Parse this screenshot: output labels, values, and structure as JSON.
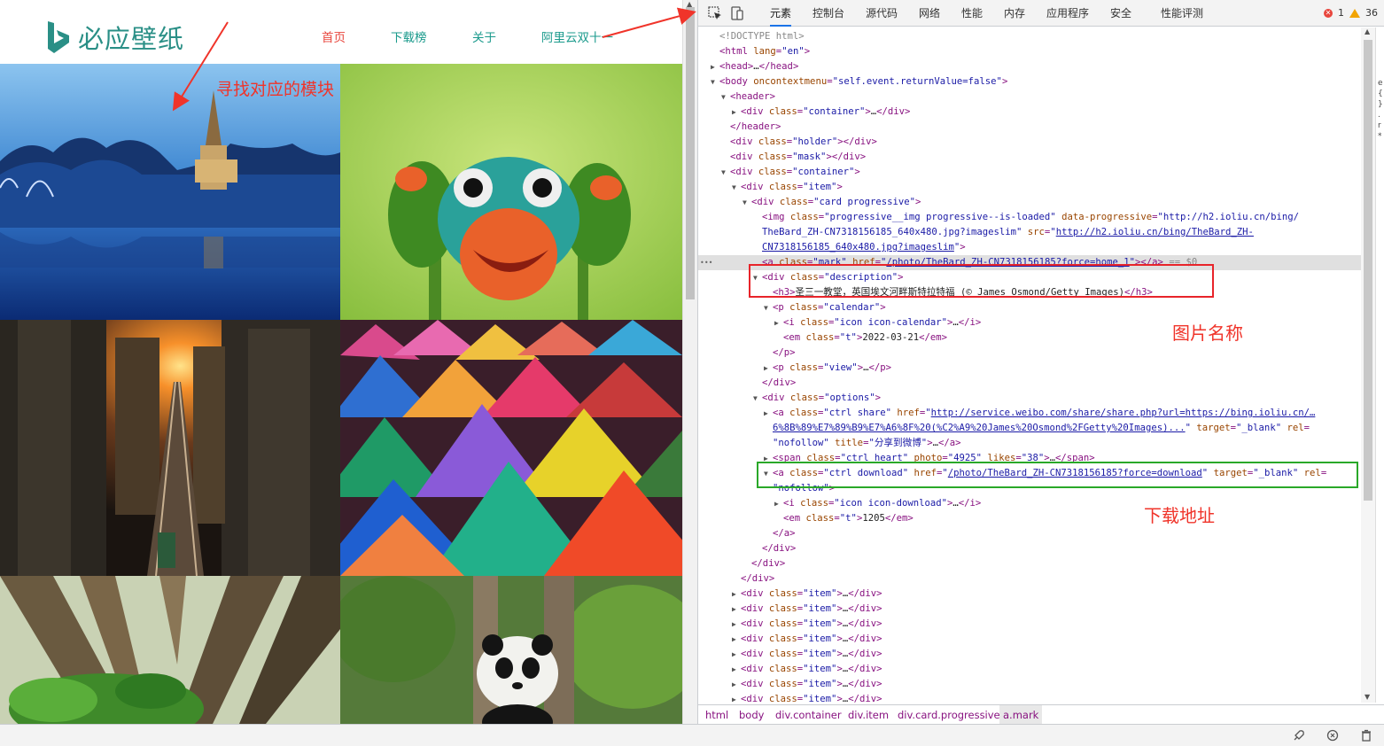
{
  "site": {
    "logo_text": "必应壁纸",
    "nav": [
      {
        "label": "首页",
        "active": true
      },
      {
        "label": "下载榜",
        "active": false
      },
      {
        "label": "关于",
        "active": false
      },
      {
        "label": "阿里云双十一",
        "active": false
      }
    ],
    "annotation": "寻找对应的模块",
    "tiles": [
      {
        "name": "church-winter-lake"
      },
      {
        "name": "frog-on-flower-bud"
      },
      {
        "name": "city-sunset-railway"
      },
      {
        "name": "colorful-powder-piles"
      },
      {
        "name": "redwood-forest"
      },
      {
        "name": "panda-on-tree"
      }
    ]
  },
  "devtools": {
    "tabs": [
      "元素",
      "控制台",
      "源代码",
      "网络",
      "性能",
      "内存",
      "应用程序",
      "安全",
      "性能评测"
    ],
    "active_tab": "元素",
    "errors": "1",
    "warnings": "36",
    "annotations": {
      "image_name": "图片名称",
      "download_url": "下载地址"
    },
    "dom_lines": [
      {
        "indent": 0,
        "tri": "",
        "html": "<span class=\"cmt\">&lt;!DOCTYPE html&gt;</span>"
      },
      {
        "indent": 0,
        "tri": "",
        "html": "<span class=\"tag\">&lt;html </span><span class=\"attr\">lang</span><span class=\"tag\">=</span><span class=\"val\">\"en\"</span><span class=\"tag\">&gt;</span>"
      },
      {
        "indent": 0,
        "tri": "▶",
        "html": "<span class=\"tag\">&lt;head&gt;</span><span class=\"txt\">…</span><span class=\"tag\">&lt;/head&gt;</span>"
      },
      {
        "indent": 0,
        "tri": "▼",
        "html": "<span class=\"tag\">&lt;body </span><span class=\"attr\">oncontextmenu</span><span class=\"tag\">=</span><span class=\"val\">\"self.event.returnValue=false\"</span><span class=\"tag\">&gt;</span>"
      },
      {
        "indent": 1,
        "tri": "▼",
        "html": "<span class=\"tag\">&lt;header&gt;</span>"
      },
      {
        "indent": 2,
        "tri": "▶",
        "html": "<span class=\"tag\">&lt;div </span><span class=\"attr\">class</span><span class=\"tag\">=</span><span class=\"val\">\"container\"</span><span class=\"tag\">&gt;</span><span class=\"txt\">…</span><span class=\"tag\">&lt;/div&gt;</span>"
      },
      {
        "indent": 1,
        "tri": "",
        "html": "<span class=\"tag\">&lt;/header&gt;</span>"
      },
      {
        "indent": 1,
        "tri": "",
        "html": "<span class=\"tag\">&lt;div </span><span class=\"attr\">class</span><span class=\"tag\">=</span><span class=\"val\">\"holder\"</span><span class=\"tag\">&gt;&lt;/div&gt;</span>"
      },
      {
        "indent": 1,
        "tri": "",
        "html": "<span class=\"tag\">&lt;div </span><span class=\"attr\">class</span><span class=\"tag\">=</span><span class=\"val\">\"mask\"</span><span class=\"tag\">&gt;&lt;/div&gt;</span>"
      },
      {
        "indent": 1,
        "tri": "▼",
        "html": "<span class=\"tag\">&lt;div </span><span class=\"attr\">class</span><span class=\"tag\">=</span><span class=\"val\">\"container\"</span><span class=\"tag\">&gt;</span>"
      },
      {
        "indent": 2,
        "tri": "▼",
        "html": "<span class=\"tag\">&lt;div </span><span class=\"attr\">class</span><span class=\"tag\">=</span><span class=\"val\">\"item\"</span><span class=\"tag\">&gt;</span>"
      },
      {
        "indent": 3,
        "tri": "▼",
        "html": "<span class=\"tag\">&lt;div </span><span class=\"attr\">class</span><span class=\"tag\">=</span><span class=\"val\">\"card progressive\"</span><span class=\"tag\">&gt;</span>"
      },
      {
        "indent": 4,
        "tri": "",
        "html": "<span class=\"tag\">&lt;img </span><span class=\"attr\">class</span><span class=\"tag\">=</span><span class=\"val\">\"progressive__img progressive--is-loaded\"</span> <span class=\"attr\">data-progressive</span><span class=\"tag\">=</span><span class=\"val\">\"http://h2.ioliu.cn/bing/</span>"
      },
      {
        "indent": 4,
        "tri": "",
        "html": "<span class=\"val\">TheBard_ZH-CN7318156185_640x480.jpg?imageslim\"</span> <span class=\"attr\">src</span><span class=\"tag\">=</span><span class=\"val\">\"</span><span class=\"link\">http://h2.ioliu.cn/bing/TheBard_ZH-</span>"
      },
      {
        "indent": 4,
        "tri": "",
        "html": "<span class=\"link\">CN7318156185_640x480.jpg?imageslim</span><span class=\"val\">\"</span><span class=\"tag\">&gt;</span>"
      },
      {
        "indent": 4,
        "tri": "",
        "sel": true,
        "html": "<span class=\"tag\">&lt;a </span><span class=\"attr\">class</span><span class=\"tag\">=</span><span class=\"val\">\"mark\"</span> <span class=\"attr\">href</span><span class=\"tag\">=</span><span class=\"val\">\"</span><span class=\"link\">/photo/TheBard_ZH-CN7318156185?force=home_1</span><span class=\"val\">\"</span><span class=\"tag\">&gt;&lt;/a&gt;</span> <span class=\"cmt\">== $0</span>"
      },
      {
        "indent": 4,
        "tri": "▼",
        "html": "<span class=\"tag\">&lt;div </span><span class=\"attr\">class</span><span class=\"tag\">=</span><span class=\"val\">\"description\"</span><span class=\"tag\">&gt;</span>"
      },
      {
        "indent": 5,
        "tri": "",
        "html": "<span class=\"tag\">&lt;h3&gt;</span><span class=\"txt\">圣三一教堂，英国埃文河畔斯特拉特福 (© James Osmond/Getty Images)</span><span class=\"tag\">&lt;/h3&gt;</span>"
      },
      {
        "indent": 5,
        "tri": "▼",
        "html": "<span class=\"tag\">&lt;p </span><span class=\"attr\">class</span><span class=\"tag\">=</span><span class=\"val\">\"calendar\"</span><span class=\"tag\">&gt;</span>"
      },
      {
        "indent": 6,
        "tri": "▶",
        "html": "<span class=\"tag\">&lt;i </span><span class=\"attr\">class</span><span class=\"tag\">=</span><span class=\"val\">\"icon icon-calendar\"</span><span class=\"tag\">&gt;</span><span class=\"txt\">…</span><span class=\"tag\">&lt;/i&gt;</span>"
      },
      {
        "indent": 6,
        "tri": "",
        "html": "<span class=\"tag\">&lt;em </span><span class=\"attr\">class</span><span class=\"tag\">=</span><span class=\"val\">\"t\"</span><span class=\"tag\">&gt;</span><span class=\"txt\">2022-03-21</span><span class=\"tag\">&lt;/em&gt;</span>"
      },
      {
        "indent": 5,
        "tri": "",
        "html": "<span class=\"tag\">&lt;/p&gt;</span>"
      },
      {
        "indent": 5,
        "tri": "▶",
        "html": "<span class=\"tag\">&lt;p </span><span class=\"attr\">class</span><span class=\"tag\">=</span><span class=\"val\">\"view\"</span><span class=\"tag\">&gt;</span><span class=\"txt\">…</span><span class=\"tag\">&lt;/p&gt;</span>"
      },
      {
        "indent": 4,
        "tri": "",
        "html": "<span class=\"tag\">&lt;/div&gt;</span>"
      },
      {
        "indent": 4,
        "tri": "▼",
        "html": "<span class=\"tag\">&lt;div </span><span class=\"attr\">class</span><span class=\"tag\">=</span><span class=\"val\">\"options\"</span><span class=\"tag\">&gt;</span>"
      },
      {
        "indent": 5,
        "tri": "▶",
        "html": "<span class=\"tag\">&lt;a </span><span class=\"attr\">class</span><span class=\"tag\">=</span><span class=\"val\">\"ctrl share\"</span> <span class=\"attr\">href</span><span class=\"tag\">=</span><span class=\"val\">\"</span><span class=\"link\">http://service.weibo.com/share/share.php?url=https://bing.ioliu.cn/…</span>"
      },
      {
        "indent": 5,
        "tri": "",
        "html": "<span class=\"link\">6%8B%89%E7%89%B9%E7%A6%8F%20(%C2%A9%20James%20Osmond%2FGetty%20Images)...</span><span class=\"val\">\"</span> <span class=\"attr\">target</span><span class=\"tag\">=</span><span class=\"val\">\"_blank\"</span> <span class=\"attr\">rel</span><span class=\"tag\">=</span>"
      },
      {
        "indent": 5,
        "tri": "",
        "html": "<span class=\"val\">\"nofollow\"</span> <span class=\"attr\">title</span><span class=\"tag\">=</span><span class=\"val\">\"分享到微博\"</span><span class=\"tag\">&gt;</span><span class=\"txt\">…</span><span class=\"tag\">&lt;/a&gt;</span>"
      },
      {
        "indent": 5,
        "tri": "▶",
        "html": "<span class=\"tag\">&lt;span </span><span class=\"attr\">class</span><span class=\"tag\">=</span><span class=\"val\">\"ctrl heart\"</span> <span class=\"attr\">photo</span><span class=\"tag\">=</span><span class=\"val\">\"4925\"</span> <span class=\"attr\">likes</span><span class=\"tag\">=</span><span class=\"val\">\"38\"</span><span class=\"tag\">&gt;</span><span class=\"txt\">…</span><span class=\"tag\">&lt;/span&gt;</span>"
      },
      {
        "indent": 5,
        "tri": "▼",
        "html": "<span class=\"tag\">&lt;a </span><span class=\"attr\">class</span><span class=\"tag\">=</span><span class=\"val\">\"ctrl download\"</span> <span class=\"attr\">href</span><span class=\"tag\">=</span><span class=\"val\">\"</span><span class=\"link\">/photo/TheBard_ZH-CN7318156185?force=download</span><span class=\"val\">\"</span> <span class=\"attr\">target</span><span class=\"tag\">=</span><span class=\"val\">\"_blank\"</span> <span class=\"attr\">rel</span><span class=\"tag\">=</span>"
      },
      {
        "indent": 5,
        "tri": "",
        "html": "<span class=\"val\">\"nofollow\"</span><span class=\"tag\">&gt;</span>"
      },
      {
        "indent": 6,
        "tri": "▶",
        "html": "<span class=\"tag\">&lt;i </span><span class=\"attr\">class</span><span class=\"tag\">=</span><span class=\"val\">\"icon icon-download\"</span><span class=\"tag\">&gt;</span><span class=\"txt\">…</span><span class=\"tag\">&lt;/i&gt;</span>"
      },
      {
        "indent": 6,
        "tri": "",
        "html": "<span class=\"tag\">&lt;em </span><span class=\"attr\">class</span><span class=\"tag\">=</span><span class=\"val\">\"t\"</span><span class=\"tag\">&gt;</span><span class=\"txt\">1205</span><span class=\"tag\">&lt;/em&gt;</span>"
      },
      {
        "indent": 5,
        "tri": "",
        "html": "<span class=\"tag\">&lt;/a&gt;</span>"
      },
      {
        "indent": 4,
        "tri": "",
        "html": "<span class=\"tag\">&lt;/div&gt;</span>"
      },
      {
        "indent": 3,
        "tri": "",
        "html": "<span class=\"tag\">&lt;/div&gt;</span>"
      },
      {
        "indent": 2,
        "tri": "",
        "html": "<span class=\"tag\">&lt;/div&gt;</span>"
      },
      {
        "indent": 2,
        "tri": "▶",
        "html": "<span class=\"tag\">&lt;div </span><span class=\"attr\">class</span><span class=\"tag\">=</span><span class=\"val\">\"item\"</span><span class=\"tag\">&gt;</span><span class=\"txt\">…</span><span class=\"tag\">&lt;/div&gt;</span>"
      },
      {
        "indent": 2,
        "tri": "▶",
        "html": "<span class=\"tag\">&lt;div </span><span class=\"attr\">class</span><span class=\"tag\">=</span><span class=\"val\">\"item\"</span><span class=\"tag\">&gt;</span><span class=\"txt\">…</span><span class=\"tag\">&lt;/div&gt;</span>"
      },
      {
        "indent": 2,
        "tri": "▶",
        "html": "<span class=\"tag\">&lt;div </span><span class=\"attr\">class</span><span class=\"tag\">=</span><span class=\"val\">\"item\"</span><span class=\"tag\">&gt;</span><span class=\"txt\">…</span><span class=\"tag\">&lt;/div&gt;</span>"
      },
      {
        "indent": 2,
        "tri": "▶",
        "html": "<span class=\"tag\">&lt;div </span><span class=\"attr\">class</span><span class=\"tag\">=</span><span class=\"val\">\"item\"</span><span class=\"tag\">&gt;</span><span class=\"txt\">…</span><span class=\"tag\">&lt;/div&gt;</span>"
      },
      {
        "indent": 2,
        "tri": "▶",
        "html": "<span class=\"tag\">&lt;div </span><span class=\"attr\">class</span><span class=\"tag\">=</span><span class=\"val\">\"item\"</span><span class=\"tag\">&gt;</span><span class=\"txt\">…</span><span class=\"tag\">&lt;/div&gt;</span>"
      },
      {
        "indent": 2,
        "tri": "▶",
        "html": "<span class=\"tag\">&lt;div </span><span class=\"attr\">class</span><span class=\"tag\">=</span><span class=\"val\">\"item\"</span><span class=\"tag\">&gt;</span><span class=\"txt\">…</span><span class=\"tag\">&lt;/div&gt;</span>"
      },
      {
        "indent": 2,
        "tri": "▶",
        "html": "<span class=\"tag\">&lt;div </span><span class=\"attr\">class</span><span class=\"tag\">=</span><span class=\"val\">\"item\"</span><span class=\"tag\">&gt;</span><span class=\"txt\">…</span><span class=\"tag\">&lt;/div&gt;</span>"
      },
      {
        "indent": 2,
        "tri": "▶",
        "html": "<span class=\"tag\">&lt;div </span><span class=\"attr\">class</span><span class=\"tag\">=</span><span class=\"val\">\"item\"</span><span class=\"tag\">&gt;</span><span class=\"txt\">…</span><span class=\"tag\">&lt;/div&gt;</span>"
      }
    ],
    "breadcrumbs": [
      "html",
      "body",
      "div.container",
      "div.item",
      "div.card.progressive",
      "a.mark"
    ],
    "active_breadcrumb": "a.mark",
    "side_strip_chars": [
      "e",
      "{",
      "}",
      ".",
      "r",
      "*"
    ]
  }
}
